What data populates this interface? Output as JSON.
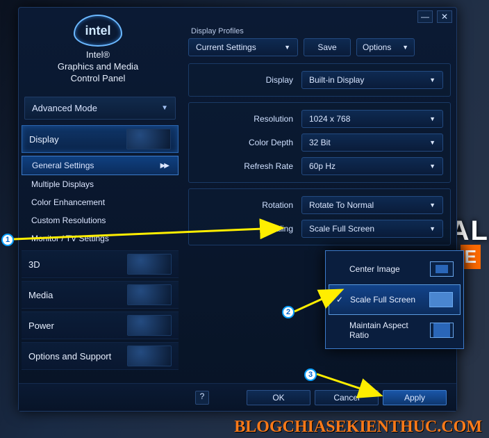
{
  "brand": "intel",
  "app_title_line1": "Intel®",
  "app_title_line2": "Graphics and Media",
  "app_title_line3": "Control Panel",
  "mode_label": "Advanced Mode",
  "categories": {
    "display": "Display",
    "threeD": "3D",
    "media": "Media",
    "power": "Power",
    "options": "Options and Support"
  },
  "display_sub": {
    "general": "General Settings",
    "multiple": "Multiple Displays",
    "colorEnh": "Color Enhancement",
    "customRes": "Custom Resolutions",
    "monitorTv": "Monitor / TV Settings"
  },
  "profiles": {
    "heading": "Display Profiles",
    "current": "Current Settings",
    "save": "Save",
    "options": "Options"
  },
  "fields": {
    "display_label": "Display",
    "display_value": "Built-in Display",
    "resolution_label": "Resolution",
    "resolution_value": "1024 x 768",
    "colordepth_label": "Color Depth",
    "colordepth_value": "32 Bit",
    "refresh_label": "Refresh Rate",
    "refresh_value": "60p Hz",
    "rotation_label": "Rotation",
    "rotation_value": "Rotate To Normal",
    "scaling_label": "Scaling",
    "scaling_value": "Scale Full Screen"
  },
  "scaling_menu": {
    "center": "Center Image",
    "full": "Scale Full Screen",
    "mar": "Maintain Aspect Ratio"
  },
  "buttons": {
    "help": "?",
    "ok": "OK",
    "cancel": "Cancel",
    "apply": "Apply"
  },
  "watermark": "BLOGCHIASEKIENTHUC.COM",
  "bg_word": "AL",
  "annotations": {
    "b1": "1",
    "b2": "2",
    "b3": "3"
  }
}
